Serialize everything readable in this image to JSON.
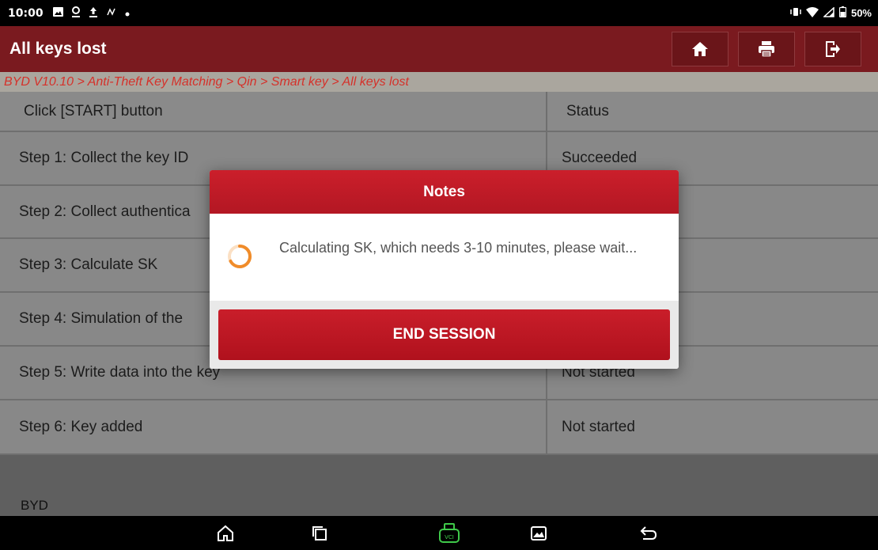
{
  "status_bar": {
    "time": "10:00",
    "battery": "50%",
    "left_icons": [
      "image-icon",
      "location-icon",
      "upload-icon",
      "signal-icon",
      "dot-icon"
    ],
    "right_icons": [
      "vibrate-icon",
      "wifi-icon",
      "cell-signal-icon",
      "battery-icon"
    ]
  },
  "titlebar": {
    "title": "All keys lost",
    "buttons": [
      "home-icon",
      "print-icon",
      "exit-icon"
    ]
  },
  "breadcrumb": "BYD V10.10 > Anti-Theft Key Matching > Qin > Smart key > All keys lost",
  "table": {
    "header": {
      "step": "Click [START] button",
      "status": "Status"
    },
    "rows": [
      {
        "step": "Step 1: Collect the key ID",
        "status": "Succeeded"
      },
      {
        "step": "Step 2: Collect authentica",
        "status": ""
      },
      {
        "step": "Step 3: Calculate SK",
        "status": ""
      },
      {
        "step": "Step 4: Simulation of the",
        "status": ""
      },
      {
        "step": "Step 5: Write data into the key",
        "status": "Not started"
      },
      {
        "step": "Step 6: Key added",
        "status": "Not started"
      }
    ]
  },
  "footer_label": "BYD",
  "modal": {
    "title": "Notes",
    "message": "Calculating SK, which needs 3-10 minutes, please wait...",
    "button": "END SESSION"
  },
  "navbar": {
    "buttons": [
      "home-icon",
      "recent-apps-icon",
      "vci-icon",
      "gallery-icon",
      "back-icon"
    ],
    "vci_label": "VCI"
  },
  "colors": {
    "titlebar": "#7a1a1f",
    "breadcrumb_text": "#d5312a",
    "modal_red": "#c01a26",
    "spinner": "#f08c2a",
    "vci_green": "#3fc94a"
  }
}
